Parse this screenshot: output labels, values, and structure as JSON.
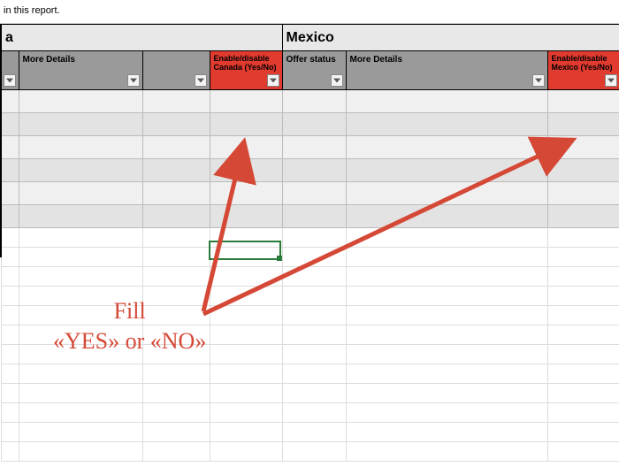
{
  "top_text": "in this report.",
  "countries": {
    "left": {
      "name_fragment": "a",
      "enable_label": "Enable/disable Canada (Yes/No)"
    },
    "right": {
      "name": "Mexico",
      "enable_label": "Enable/disable Mexico (Yes/No)"
    }
  },
  "columns": {
    "more_details": "More Details",
    "offer_status": "Offer status"
  },
  "annotation": {
    "line1": "Fill",
    "line2": "«YES» or «NO»"
  },
  "colors": {
    "header_red": "#e13a2f",
    "annotation": "#d54836"
  }
}
